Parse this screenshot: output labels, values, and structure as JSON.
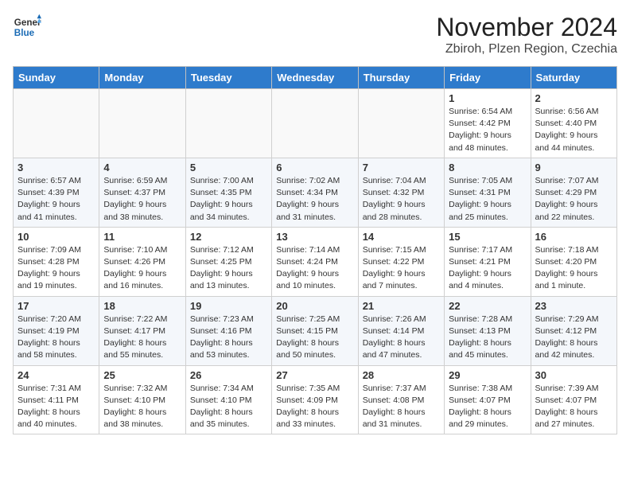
{
  "header": {
    "logo_general": "General",
    "logo_blue": "Blue",
    "month": "November 2024",
    "location": "Zbiroh, Plzen Region, Czechia"
  },
  "weekdays": [
    "Sunday",
    "Monday",
    "Tuesday",
    "Wednesday",
    "Thursday",
    "Friday",
    "Saturday"
  ],
  "weeks": [
    [
      {
        "day": "",
        "info": ""
      },
      {
        "day": "",
        "info": ""
      },
      {
        "day": "",
        "info": ""
      },
      {
        "day": "",
        "info": ""
      },
      {
        "day": "",
        "info": ""
      },
      {
        "day": "1",
        "info": "Sunrise: 6:54 AM\nSunset: 4:42 PM\nDaylight: 9 hours and 48 minutes."
      },
      {
        "day": "2",
        "info": "Sunrise: 6:56 AM\nSunset: 4:40 PM\nDaylight: 9 hours and 44 minutes."
      }
    ],
    [
      {
        "day": "3",
        "info": "Sunrise: 6:57 AM\nSunset: 4:39 PM\nDaylight: 9 hours and 41 minutes."
      },
      {
        "day": "4",
        "info": "Sunrise: 6:59 AM\nSunset: 4:37 PM\nDaylight: 9 hours and 38 minutes."
      },
      {
        "day": "5",
        "info": "Sunrise: 7:00 AM\nSunset: 4:35 PM\nDaylight: 9 hours and 34 minutes."
      },
      {
        "day": "6",
        "info": "Sunrise: 7:02 AM\nSunset: 4:34 PM\nDaylight: 9 hours and 31 minutes."
      },
      {
        "day": "7",
        "info": "Sunrise: 7:04 AM\nSunset: 4:32 PM\nDaylight: 9 hours and 28 minutes."
      },
      {
        "day": "8",
        "info": "Sunrise: 7:05 AM\nSunset: 4:31 PM\nDaylight: 9 hours and 25 minutes."
      },
      {
        "day": "9",
        "info": "Sunrise: 7:07 AM\nSunset: 4:29 PM\nDaylight: 9 hours and 22 minutes."
      }
    ],
    [
      {
        "day": "10",
        "info": "Sunrise: 7:09 AM\nSunset: 4:28 PM\nDaylight: 9 hours and 19 minutes."
      },
      {
        "day": "11",
        "info": "Sunrise: 7:10 AM\nSunset: 4:26 PM\nDaylight: 9 hours and 16 minutes."
      },
      {
        "day": "12",
        "info": "Sunrise: 7:12 AM\nSunset: 4:25 PM\nDaylight: 9 hours and 13 minutes."
      },
      {
        "day": "13",
        "info": "Sunrise: 7:14 AM\nSunset: 4:24 PM\nDaylight: 9 hours and 10 minutes."
      },
      {
        "day": "14",
        "info": "Sunrise: 7:15 AM\nSunset: 4:22 PM\nDaylight: 9 hours and 7 minutes."
      },
      {
        "day": "15",
        "info": "Sunrise: 7:17 AM\nSunset: 4:21 PM\nDaylight: 9 hours and 4 minutes."
      },
      {
        "day": "16",
        "info": "Sunrise: 7:18 AM\nSunset: 4:20 PM\nDaylight: 9 hours and 1 minute."
      }
    ],
    [
      {
        "day": "17",
        "info": "Sunrise: 7:20 AM\nSunset: 4:19 PM\nDaylight: 8 hours and 58 minutes."
      },
      {
        "day": "18",
        "info": "Sunrise: 7:22 AM\nSunset: 4:17 PM\nDaylight: 8 hours and 55 minutes."
      },
      {
        "day": "19",
        "info": "Sunrise: 7:23 AM\nSunset: 4:16 PM\nDaylight: 8 hours and 53 minutes."
      },
      {
        "day": "20",
        "info": "Sunrise: 7:25 AM\nSunset: 4:15 PM\nDaylight: 8 hours and 50 minutes."
      },
      {
        "day": "21",
        "info": "Sunrise: 7:26 AM\nSunset: 4:14 PM\nDaylight: 8 hours and 47 minutes."
      },
      {
        "day": "22",
        "info": "Sunrise: 7:28 AM\nSunset: 4:13 PM\nDaylight: 8 hours and 45 minutes."
      },
      {
        "day": "23",
        "info": "Sunrise: 7:29 AM\nSunset: 4:12 PM\nDaylight: 8 hours and 42 minutes."
      }
    ],
    [
      {
        "day": "24",
        "info": "Sunrise: 7:31 AM\nSunset: 4:11 PM\nDaylight: 8 hours and 40 minutes."
      },
      {
        "day": "25",
        "info": "Sunrise: 7:32 AM\nSunset: 4:10 PM\nDaylight: 8 hours and 38 minutes."
      },
      {
        "day": "26",
        "info": "Sunrise: 7:34 AM\nSunset: 4:10 PM\nDaylight: 8 hours and 35 minutes."
      },
      {
        "day": "27",
        "info": "Sunrise: 7:35 AM\nSunset: 4:09 PM\nDaylight: 8 hours and 33 minutes."
      },
      {
        "day": "28",
        "info": "Sunrise: 7:37 AM\nSunset: 4:08 PM\nDaylight: 8 hours and 31 minutes."
      },
      {
        "day": "29",
        "info": "Sunrise: 7:38 AM\nSunset: 4:07 PM\nDaylight: 8 hours and 29 minutes."
      },
      {
        "day": "30",
        "info": "Sunrise: 7:39 AM\nSunset: 4:07 PM\nDaylight: 8 hours and 27 minutes."
      }
    ]
  ]
}
